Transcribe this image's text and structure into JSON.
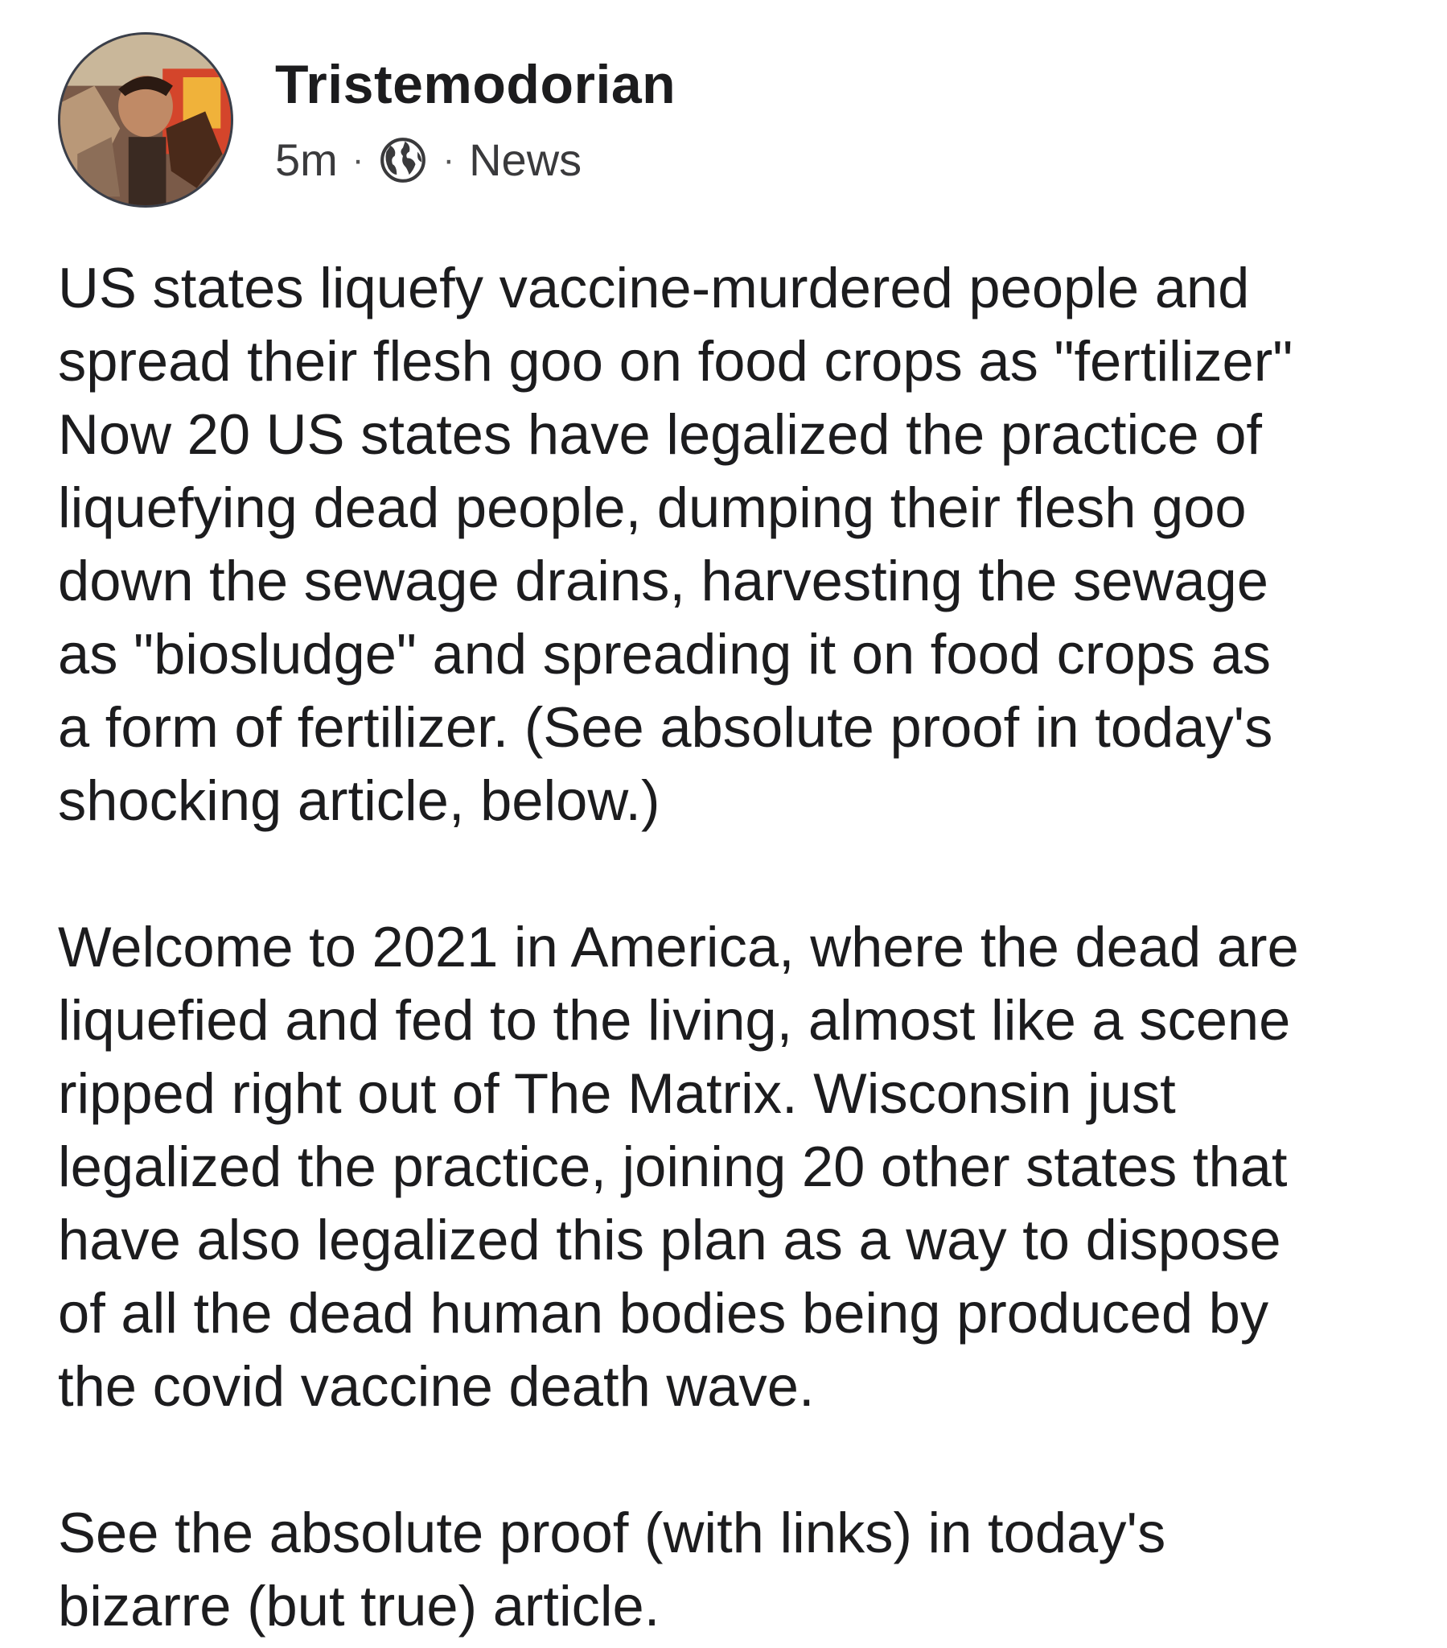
{
  "post": {
    "author": "Tristemodorian",
    "time": "5m",
    "separator": "·",
    "audience_icon": "globe-icon",
    "category": "News",
    "paragraphs": [
      "US states liquefy vaccine-murdered people and\nspread their flesh goo on food crops as \"fertilizer\"\nNow 20 US states have legalized the practice of\nliquefying dead people, dumping their flesh goo\ndown the sewage drains, harvesting the sewage\nas \"biosludge\" and spreading it on food crops as\na form of fertilizer. (See absolute proof in today's\nshocking article, below.)",
      "Welcome to 2021 in America, where the dead are\nliquefied and fed to the living, almost like a scene\nripped right out of The Matrix. Wisconsin just\nlegalized the practice, joining 20 other states that\nhave also legalized this plan as a way to dispose\nof all the dead human bodies being produced by\nthe covid vaccine death wave.",
      "See the absolute proof (with links) in today's\nbizarre (but true) article."
    ]
  }
}
